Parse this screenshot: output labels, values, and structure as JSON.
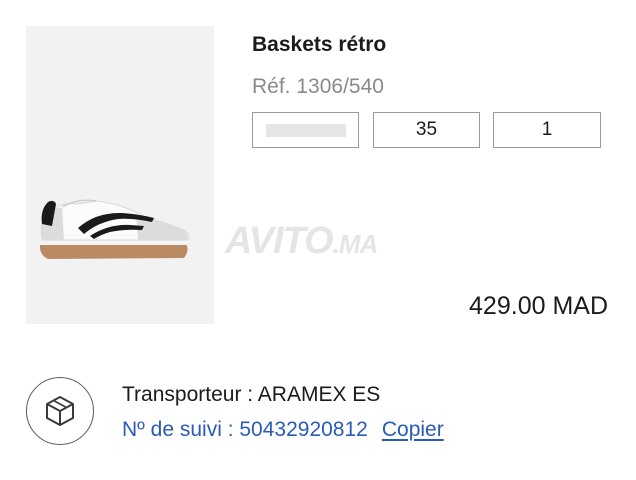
{
  "product": {
    "title": "Baskets rétro",
    "reference": "Réf. 1306/540",
    "size": "35",
    "quantity": "1",
    "price": "429.00 MAD",
    "color_swatch": "#e6e6e6"
  },
  "watermark": {
    "text": "AVITO",
    "suffix": ".MA"
  },
  "shipping": {
    "carrier_text": "Transporteur : ARAMEX ES",
    "tracking_text": "Nº de suivi : 50432920812",
    "copy_label": "Copier",
    "icon": "package-box-icon",
    "link_color": "#2a5bb8"
  }
}
